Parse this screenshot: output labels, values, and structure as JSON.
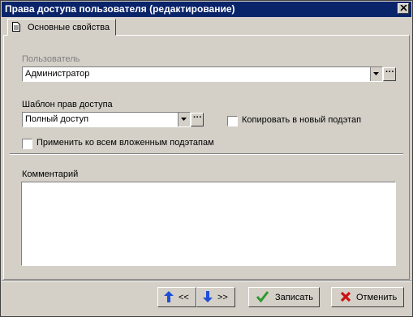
{
  "window": {
    "title": "Права доступа пользователя (редактирование)"
  },
  "tabs": [
    {
      "label": "Основные свойства"
    }
  ],
  "user": {
    "label": "Пользователь",
    "value": "Администратор"
  },
  "template": {
    "label": "Шаблон прав доступа",
    "value": "Полный доступ"
  },
  "copy_new": {
    "label": "Копировать в новый подэтап"
  },
  "apply_all": {
    "label": "Применить ко всем вложенным подэтапам"
  },
  "comment": {
    "label": "Комментарий",
    "value": ""
  },
  "buttons": {
    "prev_label": "<<",
    "next_label": ">>",
    "save_label": "Записать",
    "cancel_label": "Отменить"
  },
  "colors": {
    "title_bar": "#0a246a",
    "face": "#d4d0c8",
    "save_check": "#2e9a2e",
    "cancel_x": "#cc1111",
    "nav_arrow": "#1f4fd8"
  },
  "dots_glyph": "···"
}
